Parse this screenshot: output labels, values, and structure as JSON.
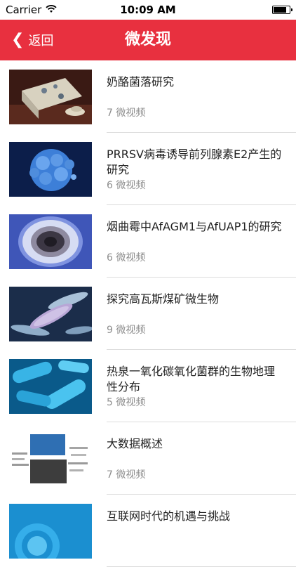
{
  "status_bar": {
    "carrier": "Carrier",
    "time": "10:09 AM",
    "battery": 0.85
  },
  "nav": {
    "back_label": "返回",
    "title": "微发现"
  },
  "items": [
    {
      "title": "奶酪菌落研究",
      "count": "7 微视频"
    },
    {
      "title": "PRRSV病毒诱导前列腺素E2产生的研究",
      "count": "6 微视频"
    },
    {
      "title": "烟曲霉中AfAGM1与AfUAP1的研究",
      "count": "6 微视频"
    },
    {
      "title": "探究高瓦斯煤矿微生物",
      "count": "9 微视频"
    },
    {
      "title": "热泉一氧化碳氧化菌群的生物地理性分布",
      "count": "5 微视频"
    },
    {
      "title": "大数据概述",
      "count": "7 微视频"
    },
    {
      "title": "互联网时代的机遇与挑战",
      "count": ""
    }
  ],
  "colors": {
    "nav_bar": "#e8303f",
    "count_text": "#8e8e8e"
  }
}
